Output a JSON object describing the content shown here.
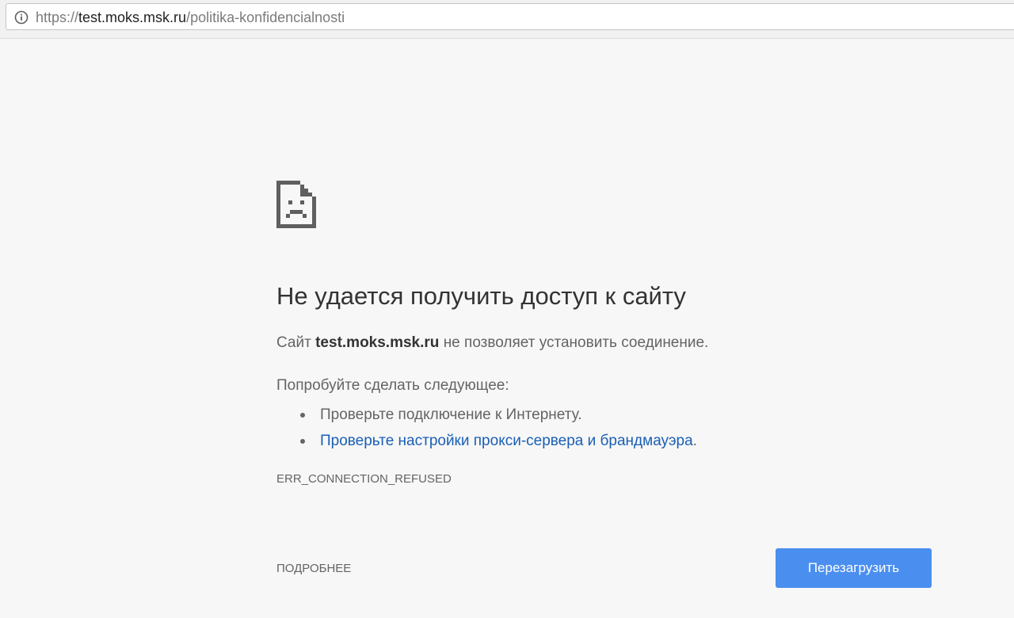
{
  "browser": {
    "url_scheme": "https://",
    "url_host": "test.moks.msk.ru",
    "url_path": "/politika-konfidencialnosti",
    "info_icon": "info-icon"
  },
  "error": {
    "icon": "sad-document-icon",
    "title": "Не удается получить доступ к сайту",
    "desc_prefix": "Сайт",
    "desc_host": "test.moks.msk.ru",
    "desc_suffix": "не позволяет установить соединение.",
    "try_label": "Попробуйте сделать следующее:",
    "suggestions": [
      "Проверьте подключение к Интернету.",
      "Проверьте настройки прокси-сервера и брандмауэра"
    ],
    "suggestion_2_period": ".",
    "code": "ERR_CONNECTION_REFUSED",
    "details_label": "ПОДРОБНЕЕ",
    "reload_label": "Перезагрузить"
  },
  "colors": {
    "background": "#f7f7f7",
    "link": "#1a5fb4",
    "button": "#4a8ef0",
    "text": "#646464",
    "heading": "#333333"
  }
}
